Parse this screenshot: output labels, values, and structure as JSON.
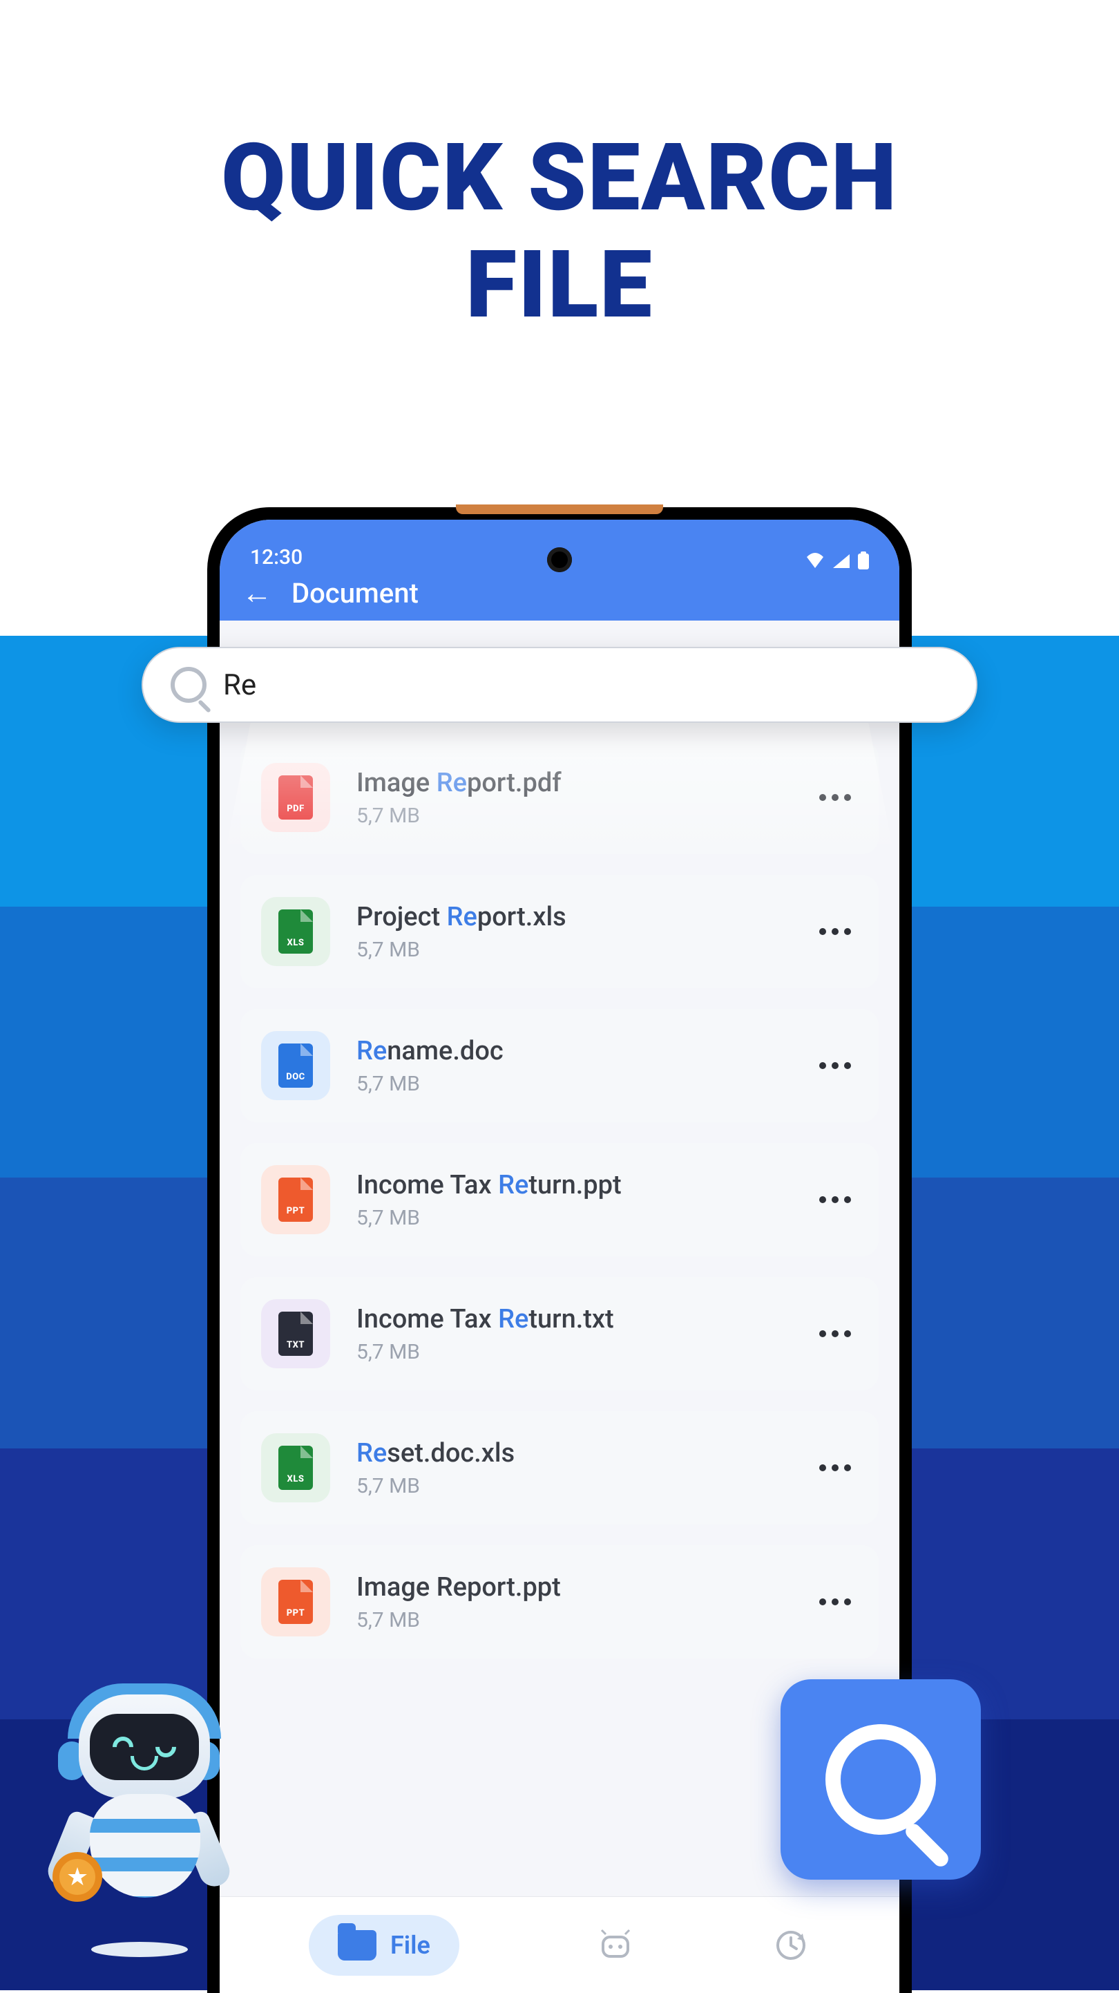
{
  "hero_title_line1": "QUICK SEARCH",
  "hero_title_line2": "FILE",
  "status": {
    "time": "12:30"
  },
  "header": {
    "title": "Document"
  },
  "search": {
    "query": "Re"
  },
  "files": [
    {
      "pre": "Image ",
      "hl": "Re",
      "post": "port.pdf",
      "size": "5,7 MB",
      "type": "PDF",
      "bg": "bg-pdf",
      "inner": "inner-pdf"
    },
    {
      "pre": "Project ",
      "hl": "Re",
      "post": "port.xls",
      "size": "5,7 MB",
      "type": "XLS",
      "bg": "bg-xls",
      "inner": "inner-xls"
    },
    {
      "pre": "",
      "hl": "Re",
      "post": "name.doc",
      "size": "5,7 MB",
      "type": "DOC",
      "bg": "bg-doc",
      "inner": "inner-doc"
    },
    {
      "pre": "Income Tax ",
      "hl": "Re",
      "post": "turn.ppt",
      "size": "5,7 MB",
      "type": "PPT",
      "bg": "bg-ppt",
      "inner": "inner-ppt"
    },
    {
      "pre": "Income Tax ",
      "hl": "Re",
      "post": "turn.txt",
      "size": "5,7 MB",
      "type": "TXT",
      "bg": "bg-txt",
      "inner": "inner-txt"
    },
    {
      "pre": "",
      "hl": "Re",
      "post": "set.doc.xls",
      "size": "5,7 MB",
      "type": "XLS",
      "bg": "bg-xls",
      "inner": "inner-xls"
    },
    {
      "pre": "Image Report.ppt",
      "hl": "",
      "post": "",
      "size": "5,7 MB",
      "type": "PPT",
      "bg": "bg-ppt",
      "inner": "inner-ppt"
    }
  ],
  "nav": {
    "file_label": "File"
  }
}
